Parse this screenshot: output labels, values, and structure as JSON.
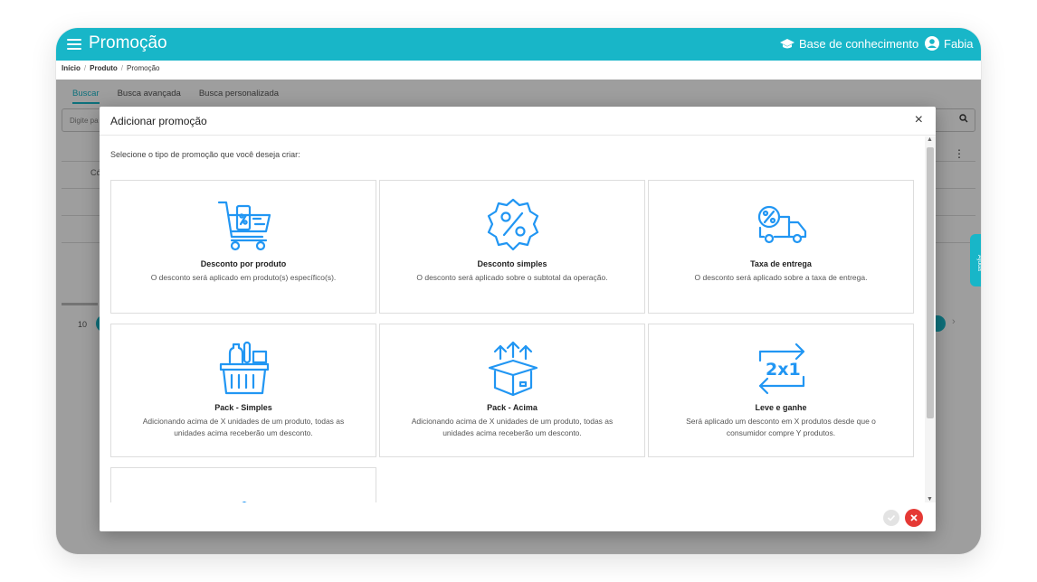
{
  "header": {
    "title": "Promoção",
    "knowledge_base": "Base de conhecimento",
    "user": "Fabia"
  },
  "breadcrumb": {
    "home": "Início",
    "sep": "/",
    "product": "Produto",
    "current": "Promoção"
  },
  "background": {
    "tabs": [
      "Buscar",
      "Busca avançada",
      "Busca personalizada"
    ],
    "search_placeholder": "Digite pa",
    "column_fragment": "Có",
    "page_size": "10",
    "side_tab": "Ajuda"
  },
  "modal": {
    "title": "Adicionar promoção",
    "instruction": "Selecione o tipo de promoção que você deseja criar:",
    "cards": [
      {
        "icon": "shopping-cart-percent-icon",
        "title": "Desconto por produto",
        "desc": "O desconto será aplicado em produto(s) específico(s)."
      },
      {
        "icon": "percent-badge-icon",
        "title": "Desconto simples",
        "desc": "O desconto será aplicado sobre o subtotal da operação."
      },
      {
        "icon": "delivery-truck-percent-icon",
        "title": "Taxa de entrega",
        "desc": "O desconto será aplicado sobre a taxa de entrega."
      },
      {
        "icon": "basket-bottles-icon",
        "title": "Pack - Simples",
        "desc": "Adicionando acima de X unidades de um produto, todas as unidades acima receberão um desconto."
      },
      {
        "icon": "open-box-arrows-icon",
        "title": "Pack - Acima",
        "desc": "Adicionando acima de X unidades de um produto, todas as unidades acima receberão um desconto."
      },
      {
        "icon": "2x1-exchange-icon",
        "title": "Leve e ganhe",
        "desc": "Será aplicado um desconto em X produtos desde que o consumidor compre Y produtos."
      },
      {
        "icon": "cube-icon",
        "title": "",
        "desc": ""
      }
    ],
    "colors": {
      "accent": "#18b6c8",
      "icon": "#2196f3",
      "cancel": "#e53935"
    }
  }
}
